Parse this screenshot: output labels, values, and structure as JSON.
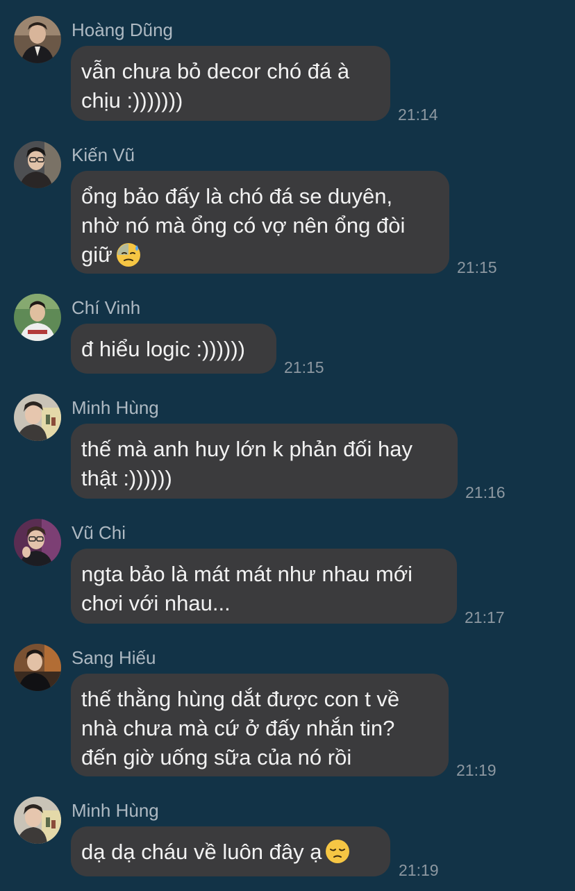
{
  "messages": [
    {
      "sender": "Hoàng Dũng",
      "text": "vẫn chưa bỏ decor chó đá à\nchịu :)))))))",
      "time": "21:14",
      "avatar_icon": "avatar-hoang-dung"
    },
    {
      "sender": "Kiến Vũ",
      "text": "ổng bảo đấy là chó đá se duyên,\nnhờ nó mà ổng có vợ nên ổng đòi\ngiữ",
      "emoji": "downcast-sweat-face",
      "time": "21:15",
      "avatar_icon": "avatar-kien-vu"
    },
    {
      "sender": "Chí Vinh",
      "text": "đ hiểu logic :))))))",
      "time": "21:15",
      "avatar_icon": "avatar-chi-vinh"
    },
    {
      "sender": "Minh Hùng",
      "text": "thế mà anh huy lớn k phản đối hay\nthật :))))))",
      "time": "21:16",
      "avatar_icon": "avatar-minh-hung"
    },
    {
      "sender": "Vũ Chi",
      "text": "ngta bảo là mát mát như nhau mới\nchơi với nhau...",
      "time": "21:17",
      "avatar_icon": "avatar-vu-chi"
    },
    {
      "sender": "Sang Hiếu",
      "text": "thế thằng hùng dắt được con t về\nnhà chưa mà cứ ở đấy nhắn tin?\nđến giờ uống sữa của nó rồi",
      "time": "21:19",
      "avatar_icon": "avatar-sang-hieu"
    },
    {
      "sender": "Minh Hùng",
      "text": "dạ dạ cháu về luôn đây ạ",
      "emoji": "pensive-face",
      "time": "21:19",
      "avatar_icon": "avatar-minh-hung"
    }
  ],
  "colors": {
    "background": "#123347",
    "bubble": "#3b3b3d",
    "message_text": "#f2f2f2",
    "sender_text": "#aeb9c2",
    "time_text": "#8d98a1"
  }
}
